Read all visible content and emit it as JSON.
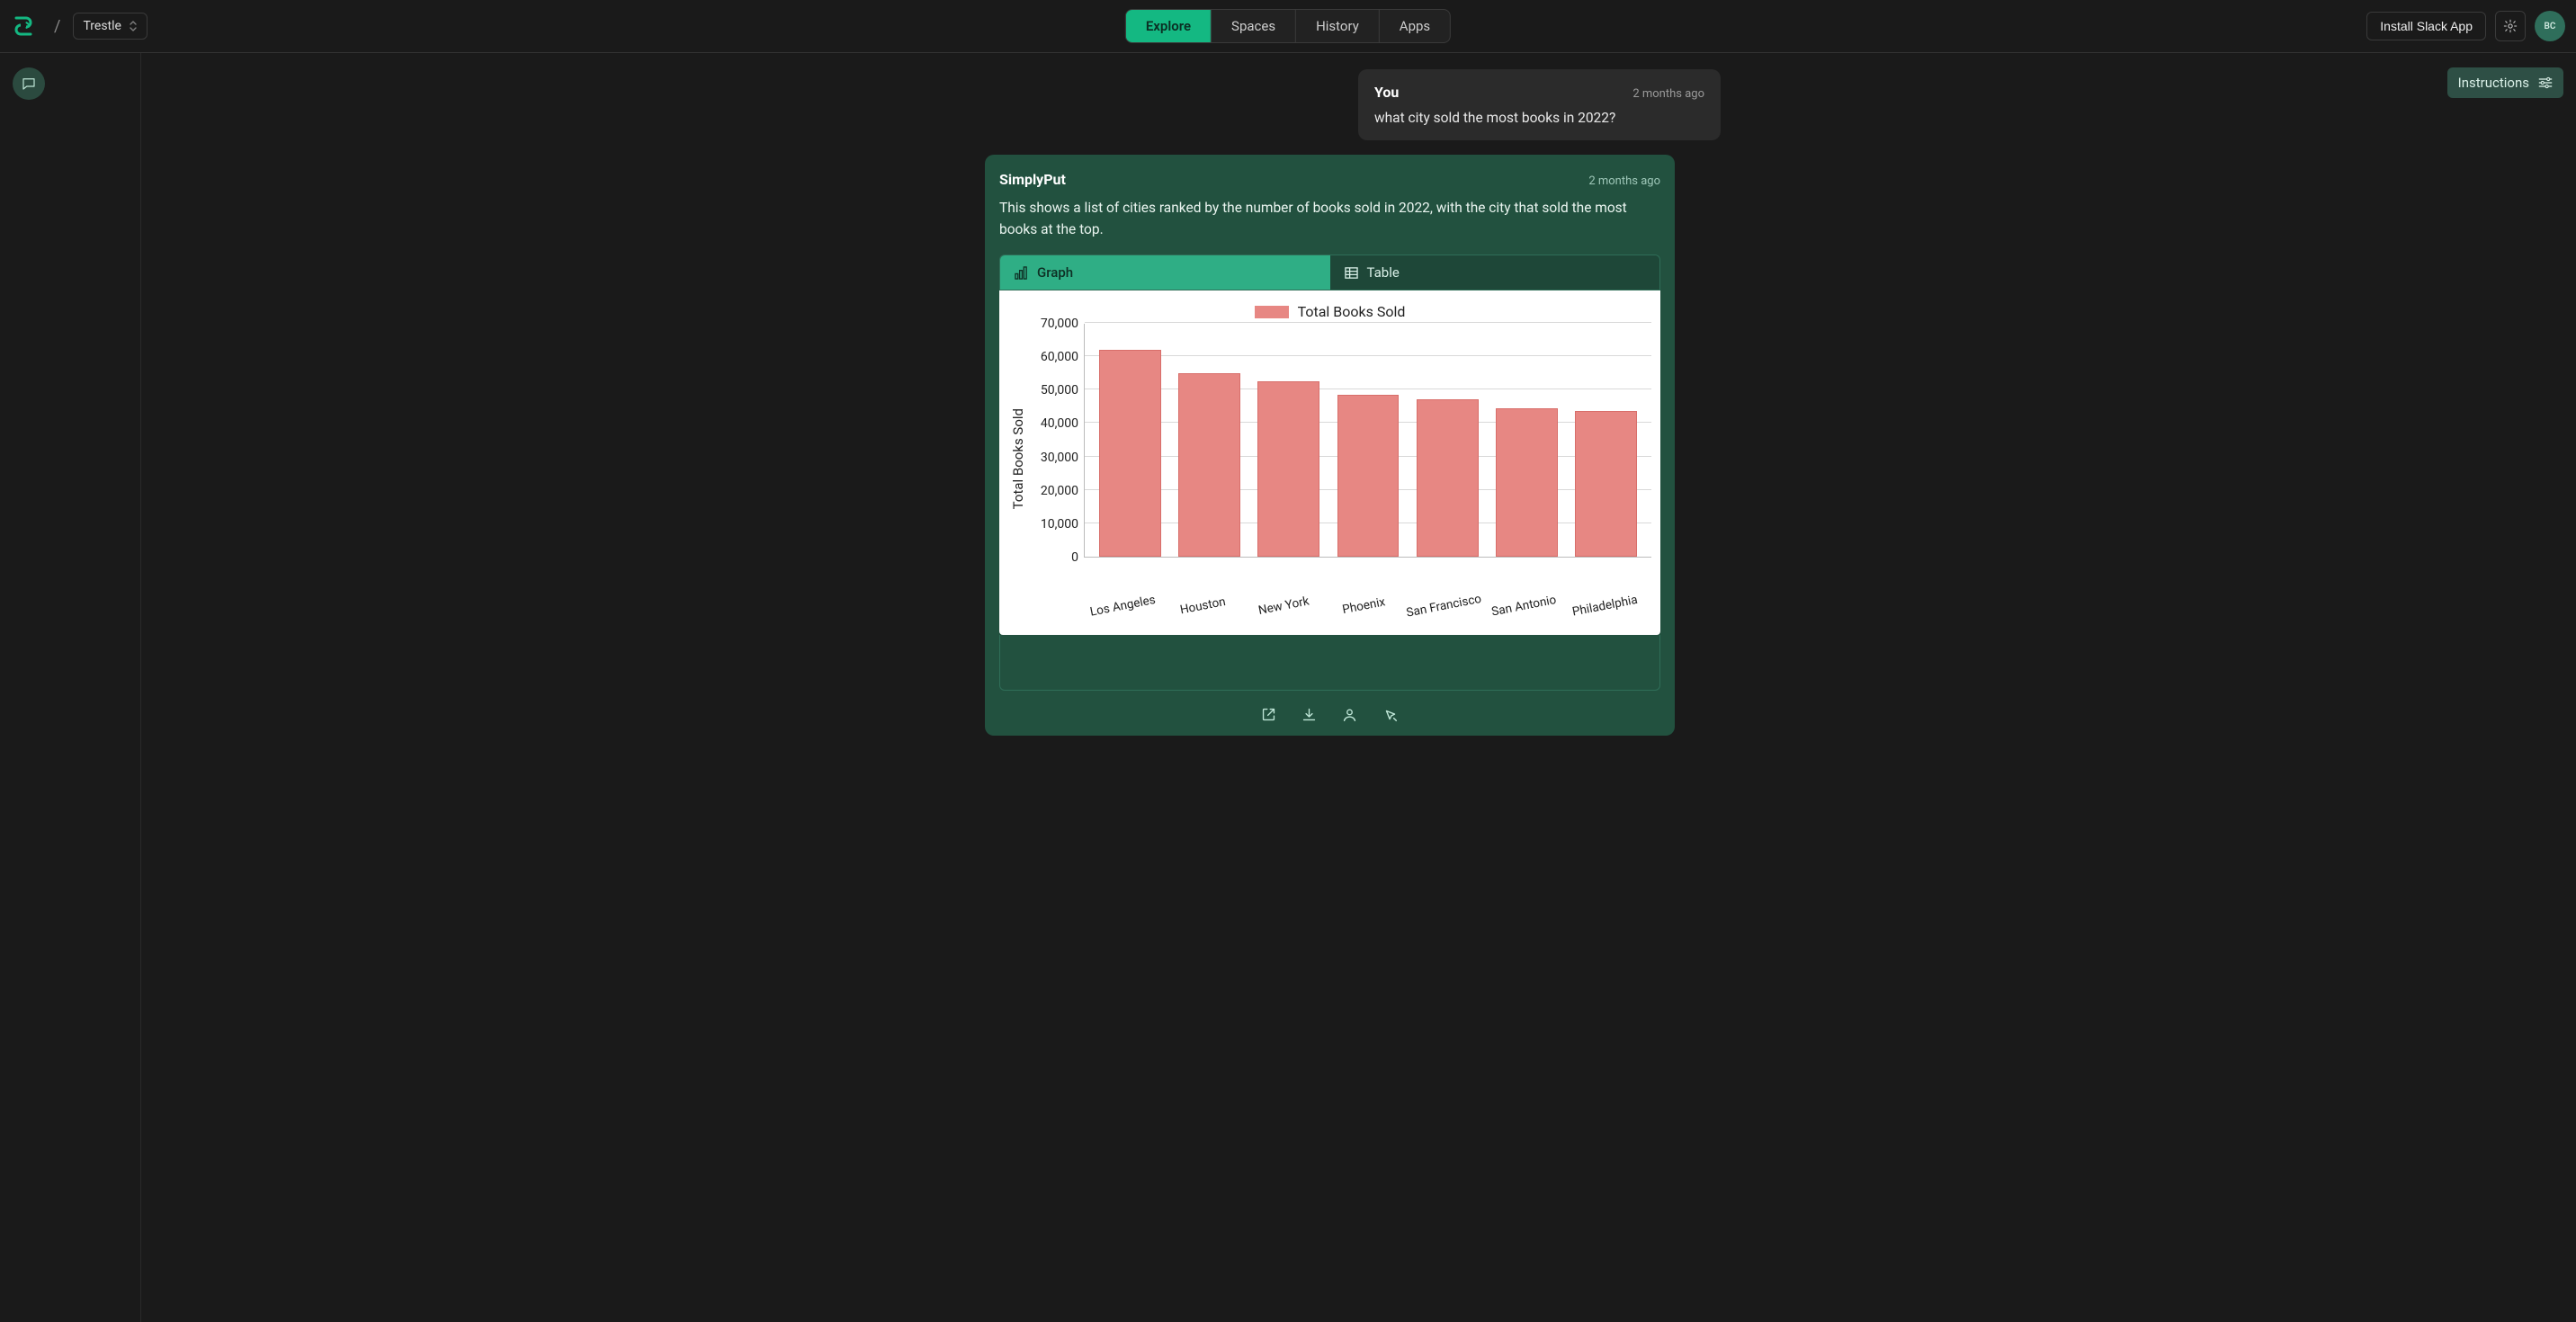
{
  "workspace": {
    "name": "Trestle"
  },
  "nav": {
    "tabs": [
      "Explore",
      "Spaces",
      "History",
      "Apps"
    ],
    "active": 0
  },
  "topbar": {
    "install_label": "Install Slack App",
    "avatar_initials": "BC"
  },
  "right_panel": {
    "instructions_label": "Instructions"
  },
  "user_message": {
    "author": "You",
    "time": "2 months ago",
    "text": "what city sold the most books in 2022?"
  },
  "ai_message": {
    "author": "SimplyPut",
    "time": "2 months ago",
    "text": "This shows a list of cities ranked by the number of books sold in 2022, with the city that sold the most books at the top.",
    "view_tabs": {
      "graph": "Graph",
      "table": "Table",
      "active": "graph"
    }
  },
  "chart_data": {
    "type": "bar",
    "title": "",
    "legend": "Total Books Sold",
    "ylabel": "Total Books Sold",
    "xlabel": "",
    "ylim": [
      0,
      70000
    ],
    "yticks": [
      0,
      10000,
      20000,
      30000,
      40000,
      50000,
      60000,
      70000
    ],
    "ytick_labels": [
      "0",
      "10,000",
      "20,000",
      "30,000",
      "40,000",
      "50,000",
      "60,000",
      "70,000"
    ],
    "categories": [
      "Los Angeles",
      "Houston",
      "New York",
      "Phoenix",
      "San Francisco",
      "San Antonio",
      "Philadelphia"
    ],
    "values": [
      62000,
      55000,
      52500,
      48500,
      47000,
      44500,
      43500
    ]
  }
}
